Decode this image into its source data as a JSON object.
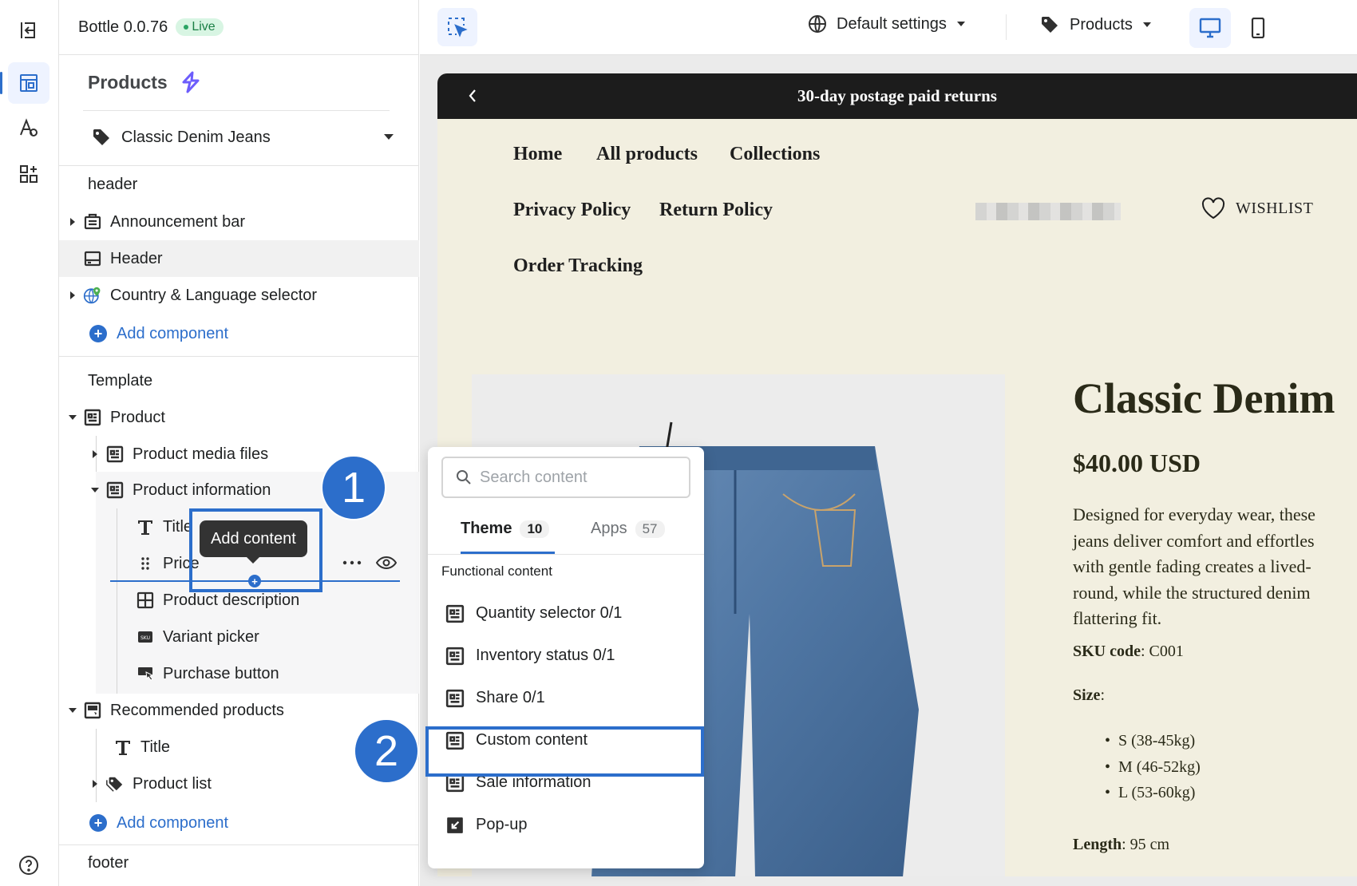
{
  "app": {
    "name": "Bottle 0.0.76",
    "status": "Live"
  },
  "sidebar": {
    "title": "Products",
    "product": "Classic Denim Jeans",
    "header_group": "header",
    "header_items": [
      {
        "label": "Announcement bar"
      },
      {
        "label": "Header"
      },
      {
        "label": "Country & Language selector"
      }
    ],
    "add_component": "Add component",
    "template_group": "Template",
    "product_section": "Product",
    "product_media": "Product media files",
    "product_information": "Product information",
    "pi_children": {
      "title": "Title",
      "price": "Price",
      "description": "Product description",
      "variant": "Variant picker",
      "purchase": "Purchase button"
    },
    "recommended": "Recommended products",
    "rec_children": {
      "title": "Title",
      "list": "Product list"
    },
    "footer_group": "footer"
  },
  "tooltip": "Add content",
  "steps": [
    "1",
    "2"
  ],
  "topbar": {
    "settings": "Default settings",
    "page_type": "Products"
  },
  "store": {
    "announcement": "30-day postage paid returns",
    "nav": [
      "Home",
      "All products",
      "Collections",
      "Privacy Policy",
      "Return Policy",
      "Order Tracking"
    ],
    "wishlist": "WISHLIST",
    "product_title": "Classic Denim",
    "price": "$40.00 USD",
    "description_lines": [
      "Designed for everyday wear, these",
      "jeans deliver comfort and effortles",
      "with gentle fading creates a lived-",
      "round, while the structured denim",
      "flattering fit."
    ],
    "sku_label": "SKU code",
    "sku_value": ": C001",
    "size_label": "Size",
    "size_colon": ":",
    "sizes": [
      "S (38-45kg)",
      "M (46-52kg)",
      "L (53-60kg)"
    ],
    "length_label": "Length",
    "length_value": ": 95 cm"
  },
  "popover": {
    "search_placeholder": "Search content",
    "tabs": [
      {
        "label": "Theme",
        "count": "10"
      },
      {
        "label": "Apps",
        "count": "57"
      }
    ],
    "section_label": "Functional content",
    "items": [
      "Quantity selector 0/1",
      "Inventory status 0/1",
      "Share 0/1",
      "Custom content",
      "Sale information",
      "Pop-up"
    ]
  },
  "colors": {
    "accent": "#2c6ecb",
    "store_bg": "#f2efe0",
    "announcement_bg": "#1c1c1c"
  }
}
